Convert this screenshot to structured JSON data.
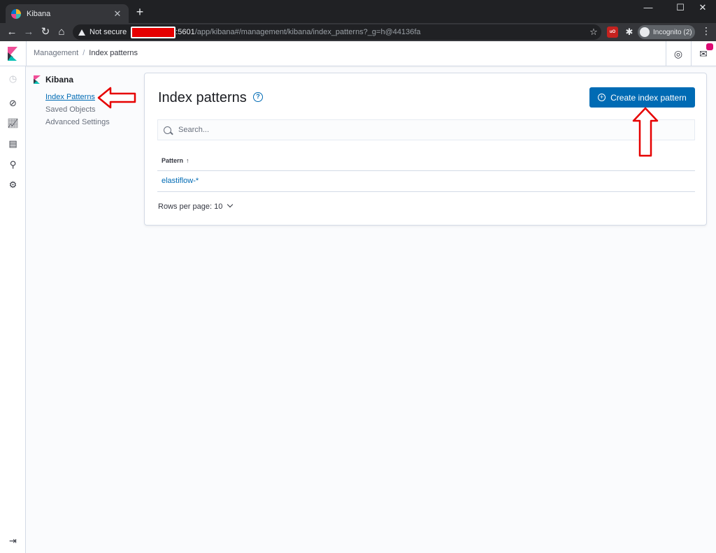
{
  "browser": {
    "tab_title": "Kibana",
    "tab_close": "✕",
    "new_tab": "+",
    "minimize": "—",
    "maximize": "☐",
    "close": "✕",
    "security_label": "Not secure",
    "url_host_suffix": ":5601",
    "url_path": "/app/kibana#/management/kibana/index_patterns?_g=h@44136fa",
    "incognito_label": "Incognito (2)",
    "ext_badge": "uO"
  },
  "header": {
    "breadcrumbs": [
      "Management",
      "Index patterns"
    ],
    "separator": "/"
  },
  "sidebar": {
    "section_title": "Kibana",
    "items": [
      {
        "label": "Index Patterns",
        "active": true
      },
      {
        "label": "Saved Objects",
        "active": false
      },
      {
        "label": "Advanced Settings",
        "active": false
      }
    ]
  },
  "main": {
    "title": "Index patterns",
    "help_glyph": "?",
    "create_button": "Create index pattern",
    "search_placeholder": "Search...",
    "table": {
      "column_header": "Pattern",
      "sort_glyph": "↑",
      "rows": [
        "elastiflow-*"
      ]
    },
    "rows_per_page": "Rows per page: 10"
  },
  "colors": {
    "primary": "#006bb4",
    "annotation_red": "#e60000",
    "badge_pink": "#dd0a73"
  }
}
